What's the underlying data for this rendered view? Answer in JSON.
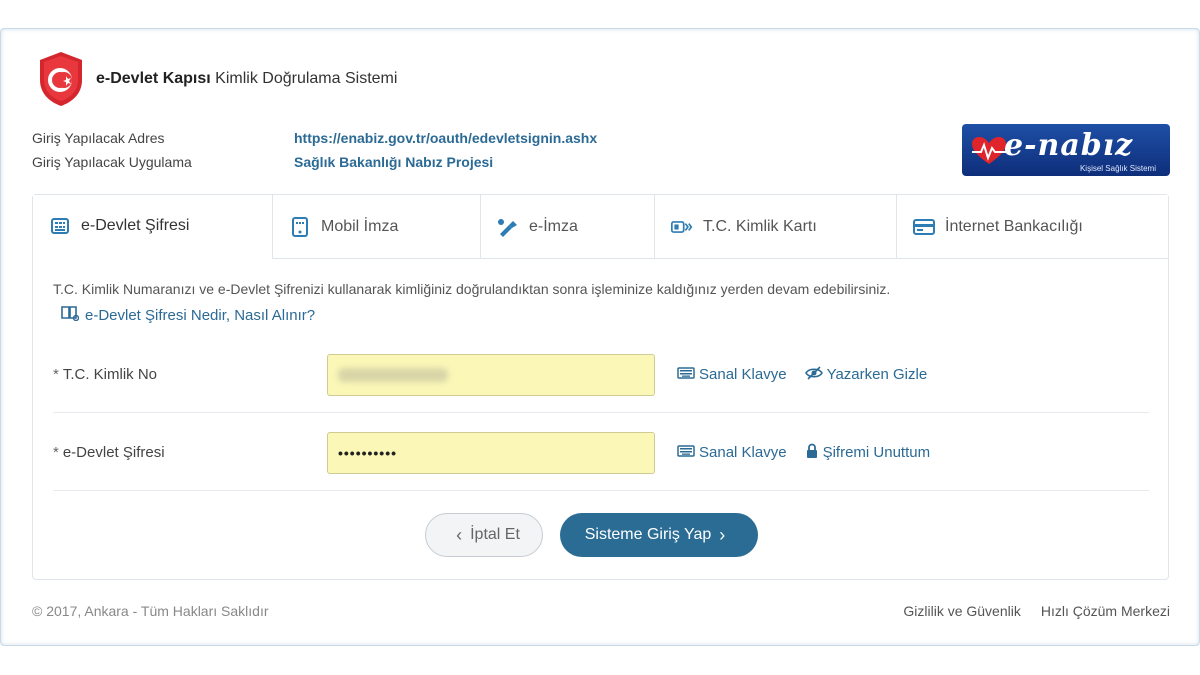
{
  "header": {
    "brand_bold": "e-Devlet Kapısı",
    "brand_rest": " Kimlik Doğrulama Sistemi"
  },
  "meta": {
    "address_label": "Giriş Yapılacak Adres",
    "address_value": "https://enabiz.gov.tr/oauth/edevletsignin.ashx",
    "app_label": "Giriş Yapılacak Uygulama",
    "app_value": "Sağlık Bakanlığı Nabız Projesi"
  },
  "logo": {
    "word": "e-nabız",
    "subtitle": "Kişisel Sağlık Sistemi"
  },
  "tabs": [
    {
      "label": "e-Devlet Şifresi",
      "icon": "keypad-icon"
    },
    {
      "label": "Mobil İmza",
      "icon": "mobile-signature-icon"
    },
    {
      "label": "e-İmza",
      "icon": "usb-signature-icon"
    },
    {
      "label": "T.C. Kimlik Kartı",
      "icon": "id-card-icon"
    },
    {
      "label": "İnternet Bankacılığı",
      "icon": "bank-card-icon"
    }
  ],
  "content": {
    "info_text": "T.C. Kimlik Numaranızı ve e-Devlet Şifrenizi kullanarak kimliğiniz doğrulandıktan sonra işleminize kaldığınız yerden devam edebilirsiniz.",
    "help_link": "e-Devlet Şifresi Nedir, Nasıl Alınır?"
  },
  "form": {
    "id_label": "T.C. Kimlik No",
    "password_label": "e-Devlet Şifresi",
    "password_value": "••••••••••",
    "virtual_keyboard": "Sanal Klavye",
    "hide_typing": "Yazarken Gizle",
    "forgot_password": "Şifremi Unuttum",
    "required_mark": "*"
  },
  "buttons": {
    "cancel": "İptal Et",
    "login": "Sisteme Giriş Yap"
  },
  "footer": {
    "copyright": "© 2017, Ankara - Tüm Hakları Saklıdır",
    "privacy": "Gizlilik ve Güvenlik",
    "help_center": "Hızlı Çözüm Merkezi"
  },
  "colors": {
    "accent": "#2a6c94",
    "link": "#2b6a95",
    "input_fill": "#faf7b7",
    "shield_red": "#d6262d"
  }
}
